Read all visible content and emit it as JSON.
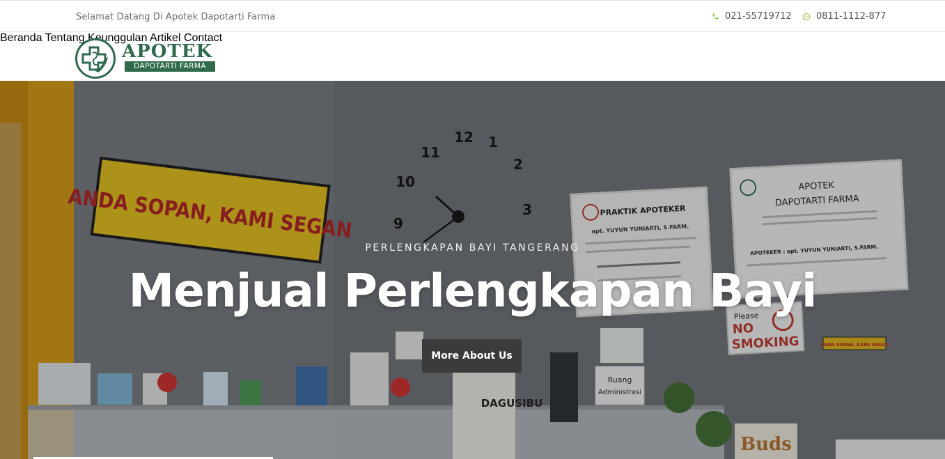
{
  "topbar": {
    "welcome": "Selamat Datang Di Apotek Dapotarti Farma",
    "phone": "021-55719712",
    "whatsapp": "0811-1112-877",
    "phone_icon": "phone-icon",
    "whatsapp_icon": "whatsapp-icon",
    "icon_color": "#8cc63f"
  },
  "logo": {
    "brand": "APOTEK",
    "subtitle": "DAPOTARTI FARMA",
    "color": "#2f6a4d"
  },
  "nav": {
    "items": [
      {
        "label": "Beranda"
      },
      {
        "label": "Tentang"
      },
      {
        "label": "Keunggulan"
      },
      {
        "label": "Artikel"
      },
      {
        "label": "Contact"
      }
    ]
  },
  "hero": {
    "eyebrow": "PERLENGKAPAN BAYI TANGERANG",
    "headline": "Menjual Perlengkapan Bayi",
    "cta_label": "More About Us",
    "photo": {
      "yellow_sign": "ANDA SOPAN, KAMI SEGAN",
      "clock_numbers": [
        "12",
        "1",
        "2",
        "3",
        "9",
        "10",
        "11"
      ],
      "poster_left_title": "PRAKTIK APOTEKER",
      "poster_left_name": "apt. YUYUN YUNIARTI, S.FARM.",
      "poster_right_line1": "APOTEK",
      "poster_right_line2": "DAPOTARTI FARMA",
      "poster_right_footer": "APOTEKER : apt. YUYUN YUNIARTI, S.FARM.",
      "no_smoking_top": "Please",
      "no_smoking_1": "NO",
      "no_smoking_2": "SMOKING",
      "small_sign": "ANDA SOPAN, KAMI SEGAN",
      "ruang_1": "Ruang",
      "ruang_2": "Administrasi",
      "box_label": "DAGUSIBU",
      "buds_label": "Buds"
    }
  }
}
